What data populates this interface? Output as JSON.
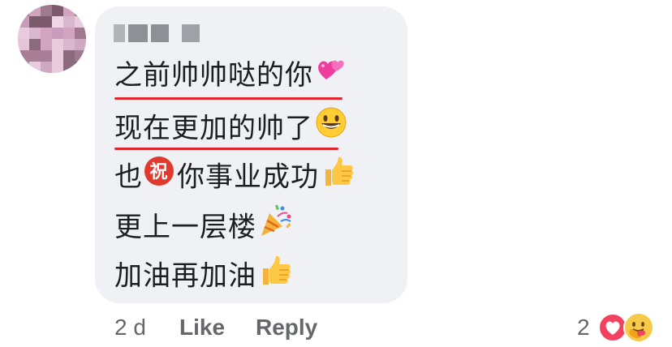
{
  "comment": {
    "lines": [
      "之前帅帅哒的你",
      "现在更加的帅了",
      "也",
      "你事业成功",
      "更上一层楼",
      "加油再加油"
    ],
    "bless_char": "祝"
  },
  "actions": {
    "time": "2 d",
    "like": "Like",
    "reply": "Reply"
  },
  "reactions": {
    "count": "2",
    "types": [
      "love-icon",
      "care-icon"
    ]
  },
  "icons": {
    "line1": "two-hearts-icon",
    "line2": "grinning-face-icon",
    "line3_mid": "congratulations-icon",
    "line3_end": "thumbs-up-icon",
    "line4": "party-popper-icon",
    "line5": "thumbs-up-icon"
  },
  "colors": {
    "bubble": "#f0f1f4",
    "underline": "#e0262c",
    "text": "#1c1e21",
    "meta": "#65676b",
    "love": "#f3425f"
  }
}
